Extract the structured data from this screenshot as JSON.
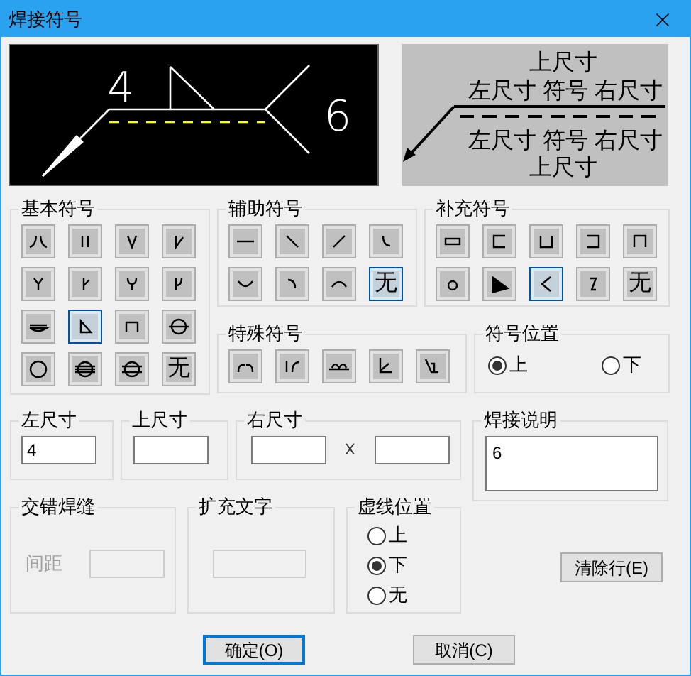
{
  "window": {
    "title": "焊接符号"
  },
  "preview": {
    "left_size": "4",
    "note": "6"
  },
  "legend": {
    "top": "上尺寸",
    "upper_row": "左尺寸 符号 右尺寸",
    "lower_row": "左尺寸 符号 右尺寸",
    "bottom": "上尺寸"
  },
  "basic_symbols": {
    "label": "基本符号",
    "buttons": [
      {
        "kind": "icon",
        "selected": false
      },
      {
        "kind": "icon",
        "selected": false
      },
      {
        "kind": "icon",
        "selected": false
      },
      {
        "kind": "icon",
        "selected": false
      },
      {
        "kind": "icon",
        "selected": false
      },
      {
        "kind": "icon",
        "selected": false
      },
      {
        "kind": "icon",
        "selected": false
      },
      {
        "kind": "icon",
        "selected": false
      },
      {
        "kind": "icon",
        "selected": false
      },
      {
        "kind": "icon",
        "selected": true
      },
      {
        "kind": "icon",
        "selected": false
      },
      {
        "kind": "icon",
        "selected": false
      },
      {
        "kind": "icon",
        "selected": false
      },
      {
        "kind": "icon",
        "selected": false
      },
      {
        "kind": "icon",
        "selected": false
      },
      {
        "kind": "text",
        "text": "无",
        "selected": false
      }
    ]
  },
  "auxiliary_symbols": {
    "label": "辅助符号",
    "buttons": [
      {
        "kind": "icon",
        "selected": false
      },
      {
        "kind": "icon",
        "selected": false
      },
      {
        "kind": "icon",
        "selected": false
      },
      {
        "kind": "icon",
        "selected": false
      },
      {
        "kind": "icon",
        "selected": false
      },
      {
        "kind": "icon",
        "selected": false
      },
      {
        "kind": "icon",
        "selected": false
      },
      {
        "kind": "text",
        "text": "无",
        "selected": true
      }
    ]
  },
  "supplementary_symbols": {
    "label": "补充符号",
    "buttons": [
      {
        "kind": "icon",
        "selected": false
      },
      {
        "kind": "icon",
        "selected": false
      },
      {
        "kind": "icon",
        "selected": false
      },
      {
        "kind": "icon",
        "selected": false
      },
      {
        "kind": "icon",
        "selected": false
      },
      {
        "kind": "icon",
        "selected": false
      },
      {
        "kind": "icon",
        "selected": false
      },
      {
        "kind": "icon",
        "selected": true
      },
      {
        "kind": "icon",
        "selected": false
      },
      {
        "kind": "text",
        "text": "无",
        "selected": false
      }
    ]
  },
  "special_symbols": {
    "label": "特殊符号",
    "buttons": [
      {
        "kind": "icon",
        "selected": false
      },
      {
        "kind": "icon",
        "selected": false
      },
      {
        "kind": "icon",
        "selected": false
      },
      {
        "kind": "icon",
        "selected": false
      },
      {
        "kind": "icon",
        "selected": false
      }
    ]
  },
  "symbol_position": {
    "label": "符号位置",
    "options": [
      {
        "label": "上",
        "selected": true
      },
      {
        "label": "下",
        "selected": false
      }
    ]
  },
  "left_size": {
    "label": "左尺寸",
    "value": "4"
  },
  "upper_size": {
    "label": "上尺寸"
  },
  "right_size": {
    "label": "右尺寸",
    "separator": "X"
  },
  "weld_note": {
    "label": "焊接说明",
    "value": "6"
  },
  "staggered_weld": {
    "label": "交错焊缝",
    "spacing_label": "间距",
    "disabled": true
  },
  "extra_text": {
    "label": "扩充文字",
    "disabled": true
  },
  "dash_position": {
    "label": "虚线位置",
    "options": [
      {
        "label": "上",
        "selected": false
      },
      {
        "label": "下",
        "selected": true
      },
      {
        "label": "无",
        "selected": false
      }
    ]
  },
  "clear_button": "清除行(E)",
  "buttons": [
    {
      "label": "确定(O)",
      "focused": true
    },
    {
      "label": "取消(C)",
      "focused": false
    }
  ]
}
